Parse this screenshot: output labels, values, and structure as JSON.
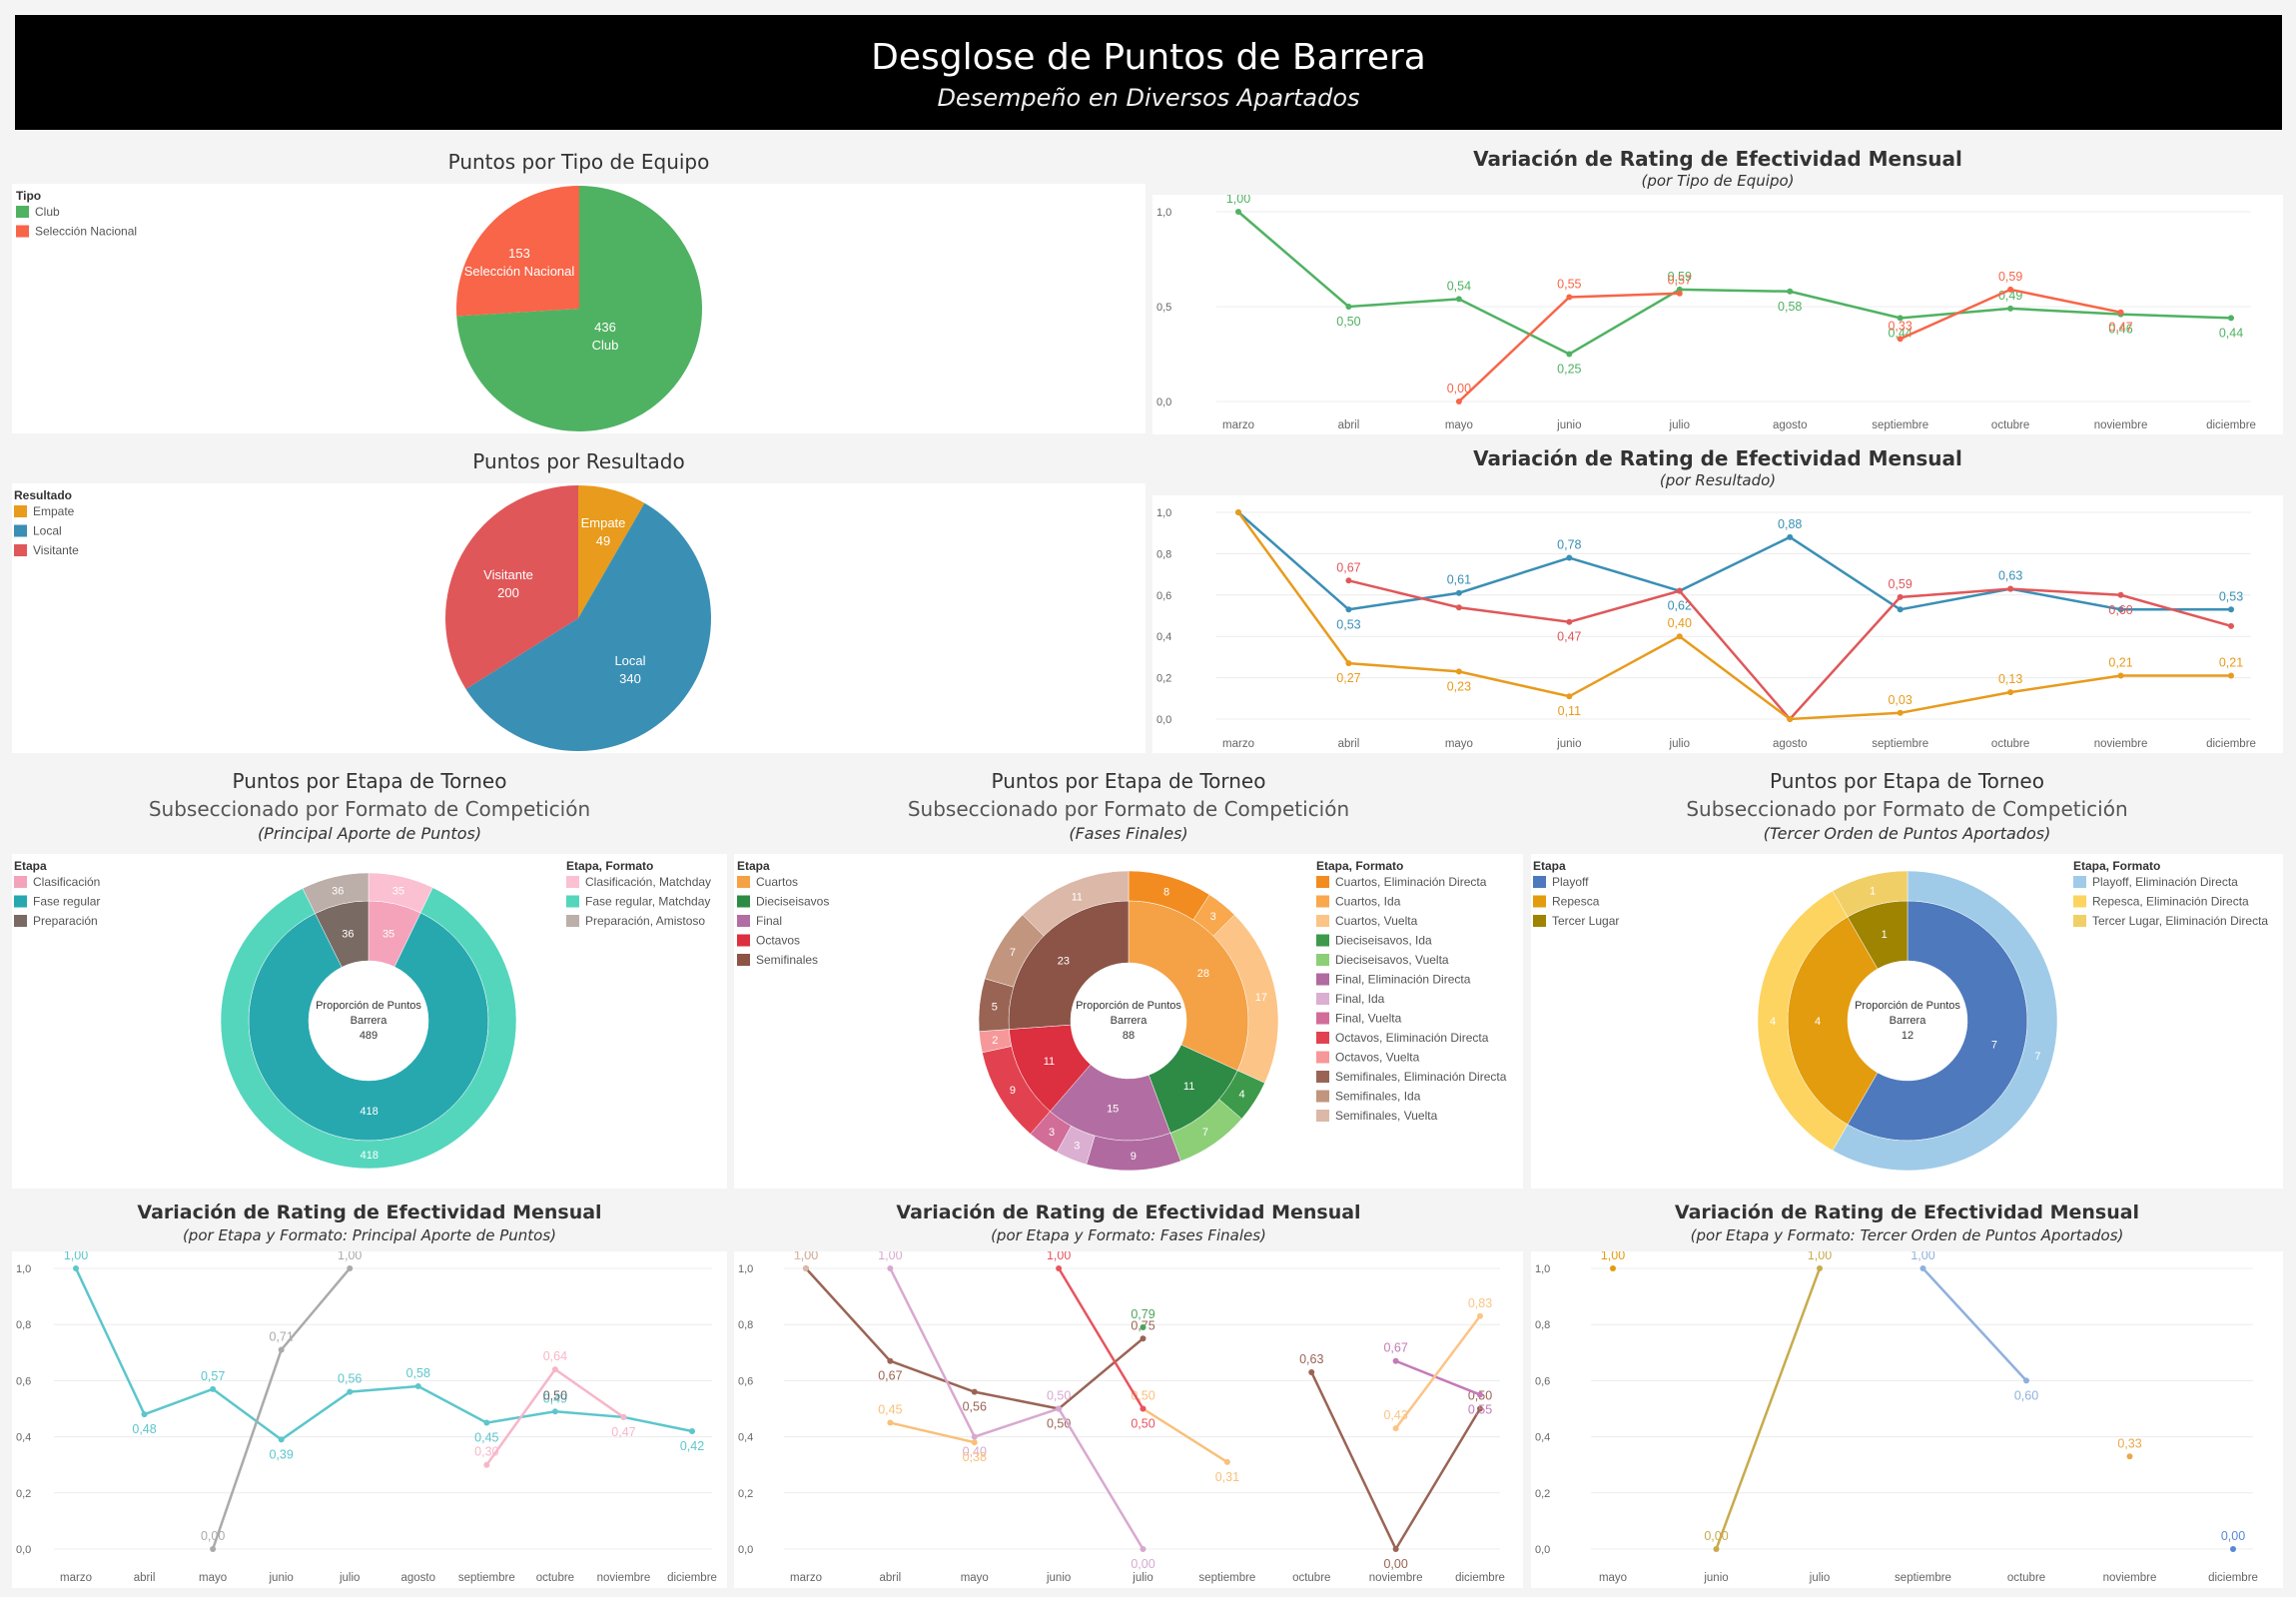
{
  "header": {
    "title": "Desglose de Puntos de Barrera",
    "subtitle": "Desempeño en Diversos Apartados"
  },
  "colors": {
    "club": "#4fb262",
    "seleccion": "#f86548",
    "empate": "#e89b1c",
    "local": "#3a8fb5",
    "visitante": "#e05759"
  },
  "pie1": {
    "title": "Puntos por Tipo de Equipo",
    "legend_title": "Tipo",
    "legend": [
      {
        "label": "Club",
        "color": "#4fb262"
      },
      {
        "label": "Selección Nacional",
        "color": "#f86548"
      }
    ],
    "slices": [
      {
        "label": "Club",
        "value": 436,
        "color": "#4fb262"
      },
      {
        "label": "Selección Nacional",
        "value": 153,
        "color": "#f86548"
      }
    ],
    "slice_texts": [
      {
        "value": "153",
        "label": "Selección Nacional"
      },
      {
        "value": "436",
        "label": "Club"
      }
    ]
  },
  "pie2": {
    "title": "Puntos por Resultado",
    "legend_title": "Resultado",
    "legend": [
      {
        "label": "Empate",
        "color": "#e89b1c"
      },
      {
        "label": "Local",
        "color": "#3a8fb5"
      },
      {
        "label": "Visitante",
        "color": "#e05759"
      }
    ],
    "slices": [
      {
        "label": "Empate",
        "value": 49,
        "color": "#e89b1c"
      },
      {
        "label": "Local",
        "value": 340,
        "color": "#3a8fb5"
      },
      {
        "label": "Visitante",
        "value": 200,
        "color": "#e05759"
      }
    ],
    "slice_texts": [
      {
        "label": "Empate",
        "value": "49"
      },
      {
        "label": "Visitante",
        "value": "200"
      },
      {
        "label": "Local",
        "value": "340"
      }
    ]
  },
  "line1": {
    "title": "Variación de Rating de Efectividad Mensual",
    "subtitle": "(por Tipo de Equipo)",
    "ylim": [
      0,
      1
    ],
    "yticks": [
      "0,0",
      "0,5",
      "1,0"
    ],
    "categories": [
      "marzo",
      "abril",
      "mayo",
      "junio",
      "julio",
      "agosto",
      "septiembre",
      "octubre",
      "noviembre",
      "diciembre"
    ],
    "series": [
      {
        "color": "#4fb262",
        "values": [
          1.0,
          0.5,
          0.54,
          0.25,
          0.59,
          0.58,
          0.44,
          0.49,
          0.46,
          0.44
        ],
        "labels": [
          "1,00",
          "0,50",
          "0,54",
          "0,25",
          "0,59",
          "0,58",
          "0,44",
          "0,49",
          "0,46",
          "0,44"
        ]
      },
      {
        "color": "#f86548",
        "values": [
          null,
          null,
          0.0,
          0.55,
          0.57,
          null,
          0.33,
          0.59,
          0.47,
          null
        ],
        "labels": [
          "",
          "",
          "0,00",
          "0,55",
          "0,57",
          "",
          "0,33",
          "0,59",
          "0,47",
          ""
        ]
      }
    ]
  },
  "line2": {
    "title": "Variación de Rating de Efectividad Mensual",
    "subtitle": "(por Resultado)",
    "ylim": [
      0,
      1
    ],
    "yticks": [
      "0,0",
      "0,2",
      "0,4",
      "0,6",
      "0,8",
      "1,0"
    ],
    "categories": [
      "marzo",
      "abril",
      "mayo",
      "junio",
      "julio",
      "agosto",
      "septiembre",
      "octubre",
      "noviembre",
      "diciembre"
    ],
    "series": [
      {
        "color": "#3a8fb5",
        "values": [
          1.0,
          0.53,
          0.61,
          0.78,
          0.62,
          0.88,
          0.53,
          0.63,
          0.53,
          0.53
        ],
        "labels": [
          "",
          "0,53",
          "0,61",
          "0,78",
          "0,62",
          "0,88",
          "",
          "0,63",
          "",
          "0,53"
        ]
      },
      {
        "color": "#e05759",
        "values": [
          null,
          0.67,
          0.54,
          0.47,
          0.62,
          0.0,
          0.59,
          0.63,
          0.6,
          0.45
        ],
        "labels": [
          "",
          "0,67",
          "",
          "0,47",
          "",
          "",
          "0,59",
          "",
          "0,60",
          ""
        ]
      },
      {
        "color": "#e89b1c",
        "values": [
          1.0,
          0.27,
          0.23,
          0.11,
          0.4,
          0.0,
          0.03,
          0.13,
          0.21,
          0.21
        ],
        "labels": [
          "",
          "0,27",
          "0,23",
          "0,11",
          "0,40",
          "",
          "0,03",
          "0,13",
          "0,21",
          "0,21"
        ]
      }
    ]
  },
  "donut1": {
    "title": "Puntos por Etapa de Torneo",
    "subtitle": "Subseccionado por Formato de Competición",
    "note": "(Principal Aporte de Puntos)",
    "center": [
      "Proporción de Puntos",
      "Barrera",
      "489"
    ],
    "legend_title": "Etapa",
    "legend": [
      {
        "label": "Clasificación",
        "color": "#f4a3bb"
      },
      {
        "label": "Fase regular",
        "color": "#27a8af"
      },
      {
        "label": "Preparación",
        "color": "#7a6a64"
      }
    ],
    "legend2_title": "Etapa, Formato",
    "legend2": [
      {
        "label": "Clasificación, Matchday",
        "color": "#fbc0d2"
      },
      {
        "label": "Fase regular, Matchday",
        "color": "#54d6bd"
      },
      {
        "label": "Preparación, Amistoso",
        "color": "#bcaea8"
      }
    ],
    "inner": [
      {
        "value": 35,
        "color": "#f4a3bb",
        "label": "35"
      },
      {
        "value": 418,
        "color": "#27a8af",
        "label": "418"
      },
      {
        "value": 36,
        "color": "#7a6a64",
        "label": "36"
      }
    ],
    "outer": [
      {
        "value": 35,
        "color": "#fbc0d2",
        "label": "35"
      },
      {
        "value": 418,
        "color": "#54d6bd",
        "label": "418"
      },
      {
        "value": 36,
        "color": "#bcaea8",
        "label": "36"
      }
    ]
  },
  "donut2": {
    "title": "Puntos por Etapa de Torneo",
    "subtitle": "Subseccionado por Formato de Competición",
    "note": "(Fases Finales)",
    "center": [
      "Proporción de Puntos",
      "Barrera",
      "88"
    ],
    "legend_title": "Etapa",
    "legend": [
      {
        "label": "Cuartos",
        "color": "#f5a145"
      },
      {
        "label": "Dieciseisavos",
        "color": "#2e8b45"
      },
      {
        "label": "Final",
        "color": "#b26ea3"
      },
      {
        "label": "Octavos",
        "color": "#dc2f3f"
      },
      {
        "label": "Semifinales",
        "color": "#8b5447"
      }
    ],
    "legend2_title": "Etapa, Formato",
    "legend2": [
      {
        "label": "Cuartos, Eliminación Directa",
        "color": "#f28c20"
      },
      {
        "label": "Cuartos, Ida",
        "color": "#f9a84e"
      },
      {
        "label": "Cuartos, Vuelta",
        "color": "#fcc486"
      },
      {
        "label": "Dieciseisavos, Ida",
        "color": "#3c9a4a"
      },
      {
        "label": "Dieciseisavos, Vuelta",
        "color": "#8ccf77"
      },
      {
        "label": "Final, Eliminación Directa",
        "color": "#b06aa0"
      },
      {
        "label": "Final, Ida",
        "color": "#dbafd1"
      },
      {
        "label": "Final, Vuelta",
        "color": "#d26d98"
      },
      {
        "label": "Octavos, Eliminación Directa",
        "color": "#e24250"
      },
      {
        "label": "Octavos, Vuelta",
        "color": "#f69899"
      },
      {
        "label": "Semifinales, Eliminación Directa",
        "color": "#9a6455"
      },
      {
        "label": "Semifinales, Ida",
        "color": "#c2957f"
      },
      {
        "label": "Semifinales, Vuelta",
        "color": "#dcb8a8"
      }
    ],
    "inner": [
      {
        "value": 28,
        "color": "#f5a145",
        "label": "28"
      },
      {
        "value": 11,
        "color": "#2e8b45",
        "label": "11"
      },
      {
        "value": 15,
        "color": "#b26ea3",
        "label": "15"
      },
      {
        "value": 11,
        "color": "#dc2f3f",
        "label": "11"
      },
      {
        "value": 23,
        "color": "#8b5447",
        "label": "23"
      }
    ],
    "outer": [
      {
        "value": 8,
        "color": "#f28c20",
        "label": "8"
      },
      {
        "value": 3,
        "color": "#f9a84e",
        "label": "3"
      },
      {
        "value": 17,
        "color": "#fcc486",
        "label": "17"
      },
      {
        "value": 4,
        "color": "#3c9a4a",
        "label": "4"
      },
      {
        "value": 7,
        "color": "#8ccf77",
        "label": "7"
      },
      {
        "value": 9,
        "color": "#b06aa0",
        "label": "9"
      },
      {
        "value": 3,
        "color": "#dbafd1",
        "label": "3"
      },
      {
        "value": 3,
        "color": "#d26d98",
        "label": "3"
      },
      {
        "value": 9,
        "color": "#e24250",
        "label": "9"
      },
      {
        "value": 2,
        "color": "#f69899",
        "label": "2"
      },
      {
        "value": 5,
        "color": "#9a6455",
        "label": "5"
      },
      {
        "value": 7,
        "color": "#c2957f",
        "label": "7"
      },
      {
        "value": 11,
        "color": "#dcb8a8",
        "label": "11"
      }
    ]
  },
  "donut3": {
    "title": "Puntos por Etapa de Torneo",
    "subtitle": "Subseccionado por Formato de Competición",
    "note": "(Tercer Orden de Puntos Aportados)",
    "center": [
      "Proporción de Puntos",
      "Barrera",
      "12"
    ],
    "legend_title": "Etapa",
    "legend": [
      {
        "label": "Playoff",
        "color": "#4e79bd"
      },
      {
        "label": "Repesca",
        "color": "#e39c0e"
      },
      {
        "label": "Tercer Lugar",
        "color": "#9e8400"
      }
    ],
    "legend2_title": "Etapa, Formato",
    "legend2": [
      {
        "label": "Playoff, Eliminación Directa",
        "color": "#9fcbe8"
      },
      {
        "label": "Repesca, Eliminación Directa",
        "color": "#fcd45f"
      },
      {
        "label": "Tercer Lugar, Eliminación Directa",
        "color": "#f1cf67"
      }
    ],
    "inner": [
      {
        "value": 7,
        "color": "#4e79bd",
        "label": "7"
      },
      {
        "value": 4,
        "color": "#e39c0e",
        "label": "4"
      },
      {
        "value": 1,
        "color": "#9e8400",
        "label": "1"
      }
    ],
    "outer": [
      {
        "value": 7,
        "color": "#9fcbe8",
        "label": "7"
      },
      {
        "value": 4,
        "color": "#fcd45f",
        "label": "4"
      },
      {
        "value": 1,
        "color": "#f1cf67",
        "label": "1"
      }
    ]
  },
  "line3": {
    "title": "Variación de Rating de Efectividad Mensual",
    "subtitle": "(por Etapa y Formato: Principal Aporte de Puntos)",
    "ylim": [
      0,
      1
    ],
    "yticks": [
      "0,0",
      "0,2",
      "0,4",
      "0,6",
      "0,8",
      "1,0"
    ],
    "categories": [
      "marzo",
      "abril",
      "mayo",
      "junio",
      "julio",
      "agosto",
      "septiembre",
      "octubre",
      "noviembre",
      "diciembre"
    ],
    "series": [
      {
        "color": "#5cc6cc",
        "values": [
          1.0,
          0.48,
          0.57,
          0.39,
          0.56,
          0.58,
          0.45,
          0.49,
          0.47,
          0.42
        ],
        "labels": [
          "1,00",
          "0,48",
          "0,57",
          "0,39",
          "0,56",
          "0,58",
          "0,45",
          "0,49",
          "",
          "0,42"
        ]
      },
      {
        "color": "#aaaaaa",
        "values": [
          null,
          null,
          0.0,
          0.71,
          1.0,
          null,
          null,
          null,
          null,
          null
        ],
        "labels": [
          "",
          "",
          "0,00",
          "0,71",
          "1,00",
          "",
          "",
          "",
          "",
          ""
        ]
      },
      {
        "color": "#f7b6c8",
        "values": [
          null,
          null,
          null,
          null,
          null,
          null,
          0.3,
          0.64,
          0.47,
          null
        ],
        "labels": [
          "",
          "",
          "",
          "",
          "",
          "",
          "0,30",
          "0,64",
          "0,47",
          ""
        ]
      }
    ],
    "extra_labels": [
      {
        "x": 7,
        "y": 0.5,
        "text": "0,50",
        "color": "#666666"
      }
    ]
  },
  "line4": {
    "title": "Variación de Rating de Efectividad Mensual",
    "subtitle": "(por Etapa y Formato: Fases Finales)",
    "ylim": [
      0,
      1
    ],
    "yticks": [
      "0,0",
      "0,2",
      "0,4",
      "0,6",
      "0,8",
      "1,0"
    ],
    "categories": [
      "marzo",
      "abril",
      "mayo",
      "junio",
      "julio",
      "septiembre",
      "octubre",
      "noviembre",
      "diciembre"
    ],
    "series": [
      {
        "color": "#9a6455",
        "values": [
          1.0,
          0.67,
          0.56,
          0.5,
          0.75,
          null,
          null,
          null,
          null
        ],
        "labels": [
          "1,00",
          "0,67",
          "0,56",
          "0,50",
          "0,75",
          "",
          "",
          "",
          ""
        ]
      },
      {
        "color": "#9a6455",
        "values": [
          null,
          null,
          null,
          null,
          null,
          null,
          0.63,
          0.0,
          0.5
        ],
        "labels": [
          "",
          "",
          "",
          "",
          "",
          "",
          "0,63",
          "0,00",
          "0,50"
        ]
      },
      {
        "color": "#dcb8a8",
        "values": [
          1.0,
          null,
          null,
          null,
          null,
          null,
          null,
          null,
          null
        ],
        "labels": [
          "1,00",
          "",
          "",
          "",
          "",
          "",
          "",
          "",
          ""
        ]
      },
      {
        "color": "#d8a9d0",
        "values": [
          null,
          1.0,
          0.4,
          0.5,
          0.0,
          null,
          null,
          null,
          null
        ],
        "labels": [
          "",
          "1,00",
          "0,40",
          "0,50",
          "0,00",
          "",
          "",
          "",
          ""
        ]
      },
      {
        "color": "#f9c07a",
        "values": [
          null,
          0.45,
          0.38,
          null,
          null,
          null,
          null,
          null,
          null
        ],
        "labels": [
          "",
          "0,45",
          "0,38",
          "",
          "",
          "",
          "",
          "",
          ""
        ]
      },
      {
        "color": "#f9c07a",
        "values": [
          null,
          null,
          null,
          null,
          0.5,
          0.31,
          null,
          null,
          null
        ],
        "labels": [
          "",
          "",
          "",
          "",
          "0,50",
          "0,31",
          "",
          "",
          ""
        ]
      },
      {
        "color": "#e8545e",
        "values": [
          null,
          null,
          null,
          1.0,
          0.5,
          null,
          null,
          null,
          null
        ],
        "labels": [
          "",
          "",
          "",
          "1,00",
          "0,50",
          "",
          "",
          "",
          ""
        ]
      },
      {
        "color": "#4aa45a",
        "values": [
          null,
          null,
          null,
          null,
          0.79,
          null,
          null,
          null,
          null
        ],
        "labels": [
          "",
          "",
          "",
          "",
          "0,79",
          "",
          "",
          "",
          ""
        ]
      },
      {
        "color": "#c47bb7",
        "values": [
          null,
          null,
          null,
          null,
          null,
          null,
          null,
          0.67,
          0.55
        ],
        "labels": [
          "",
          "",
          "",
          "",
          "",
          "",
          "",
          "0,67",
          "0,55"
        ]
      },
      {
        "color": "#fcc486",
        "values": [
          null,
          null,
          null,
          null,
          null,
          null,
          null,
          0.43,
          0.83
        ],
        "labels": [
          "",
          "",
          "",
          "",
          "",
          "",
          "",
          "0,43",
          "0,83"
        ]
      }
    ]
  },
  "line5": {
    "title": "Variación de Rating de Efectividad Mensual",
    "subtitle": "(por Etapa y Formato: Tercer Orden de Puntos Aportados)",
    "ylim": [
      0,
      1
    ],
    "yticks": [
      "0,0",
      "0,2",
      "0,4",
      "0,6",
      "0,8",
      "1,0"
    ],
    "categories": [
      "mayo",
      "junio",
      "julio",
      "septiembre",
      "octubre",
      "noviembre",
      "diciembre"
    ],
    "series": [
      {
        "color": "#e39c0e",
        "values": [
          1.0,
          null,
          null,
          null,
          null,
          null,
          null
        ],
        "labels": [
          "1,00",
          "",
          "",
          "",
          "",
          "",
          ""
        ]
      },
      {
        "color": "#c7ab4c",
        "values": [
          null,
          0.0,
          1.0,
          null,
          null,
          null,
          null
        ],
        "labels": [
          "",
          "0,00",
          "1,00",
          "",
          "",
          "",
          ""
        ]
      },
      {
        "color": "#8fb0de",
        "values": [
          null,
          null,
          null,
          1.0,
          0.6,
          null,
          null
        ],
        "labels": [
          "",
          "",
          "",
          "1,00",
          "0,60",
          "",
          ""
        ]
      },
      {
        "color": "#e8a94a",
        "values": [
          null,
          null,
          null,
          null,
          null,
          0.33,
          null
        ],
        "labels": [
          "",
          "",
          "",
          "",
          "",
          "0,33",
          ""
        ]
      },
      {
        "color": "#5a86d6",
        "values": [
          null,
          null,
          null,
          null,
          null,
          null,
          0.0
        ],
        "labels": [
          "",
          "",
          "",
          "",
          "",
          "",
          "0,00"
        ]
      }
    ]
  }
}
